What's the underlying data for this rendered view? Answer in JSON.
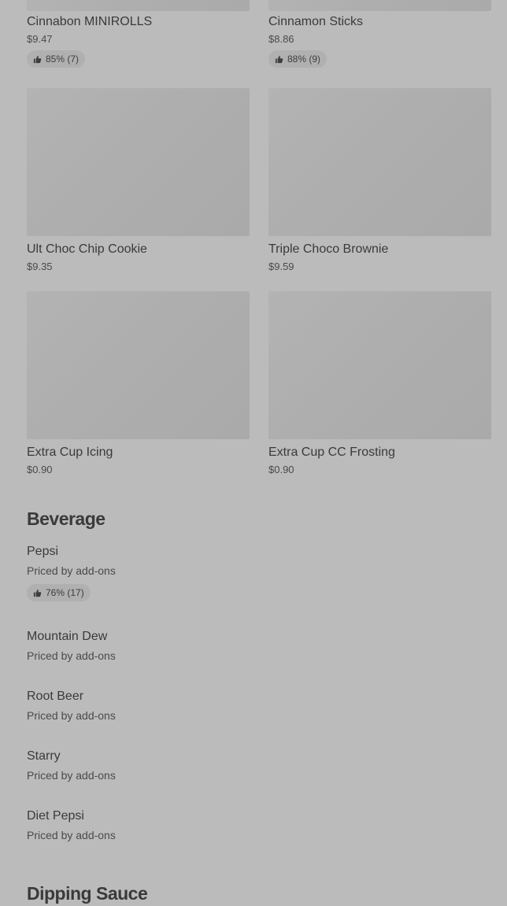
{
  "products_top": [
    {
      "name": "Cinnabon MINIROLLS",
      "price": "$9.47",
      "rating": "85% (7)"
    },
    {
      "name": "Cinnamon Sticks",
      "price": "$8.86",
      "rating": "88% (9)"
    }
  ],
  "products_mid": [
    {
      "name": "Ult Choc Chip Cookie",
      "price": "$9.35"
    },
    {
      "name": "Triple Choco Brownie",
      "price": "$9.59"
    }
  ],
  "products_bottom": [
    {
      "name": "Extra Cup Icing",
      "price": "$0.90"
    },
    {
      "name": "Extra Cup CC Frosting",
      "price": "$0.90"
    }
  ],
  "beverage": {
    "title": "Beverage",
    "items": [
      {
        "name": "Pepsi",
        "sub": "Priced by add-ons",
        "rating": "76% (17)"
      },
      {
        "name": "Mountain Dew",
        "sub": "Priced by add-ons"
      },
      {
        "name": "Root Beer",
        "sub": "Priced by add-ons"
      },
      {
        "name": "Starry",
        "sub": "Priced by add-ons"
      },
      {
        "name": "Diet Pepsi",
        "sub": "Priced by add-ons"
      }
    ]
  },
  "dipping_sauce": {
    "title": "Dipping Sauce"
  },
  "icons": {
    "rating": "thumbs-up-icon"
  }
}
